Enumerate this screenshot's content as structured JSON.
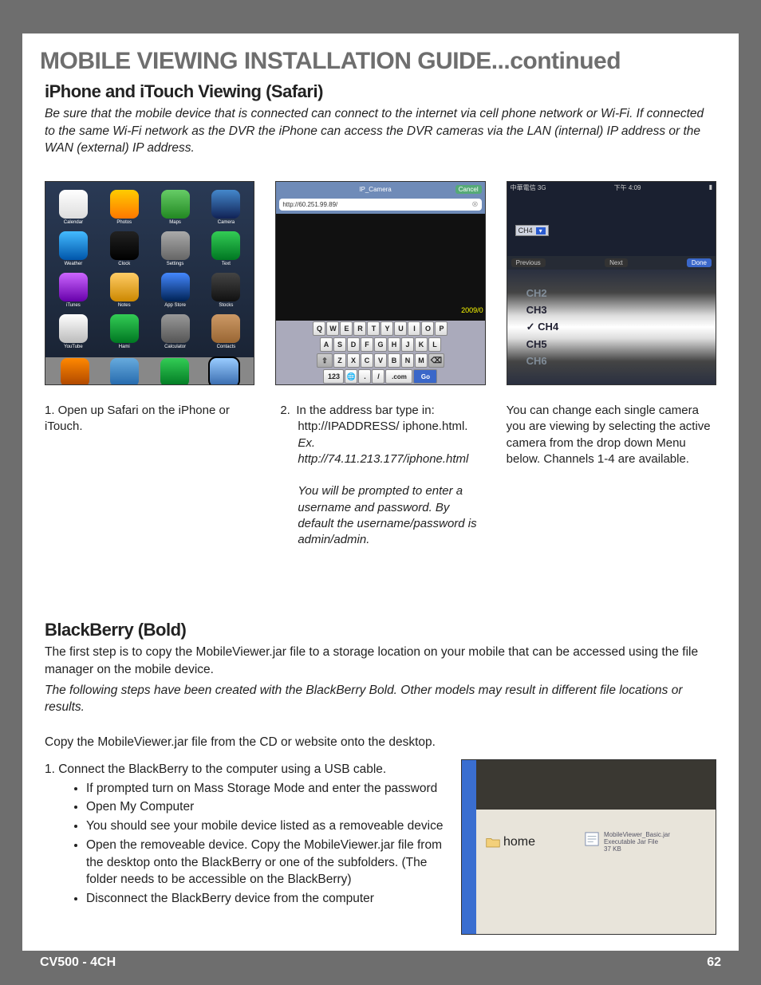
{
  "section_title": "MOBILE VIEWING INSTALLATION GUIDE...continued",
  "iphone": {
    "title": "iPhone and iTouch Viewing (Safari)",
    "intro": "Be sure that the mobile device that is connected can connect to the internet via cell phone network or Wi-Fi. If connected to the same Wi-Fi network as the DVR the iPhone can access the DVR cameras via the LAN (internal) IP address or the WAN (external) IP address.",
    "home_icons": [
      "Calendar",
      "Photos",
      "Maps",
      "Camera",
      "Weather",
      "Clock",
      "Settings",
      "Text",
      "iTunes",
      "Notes",
      "App Store",
      "Stocks",
      "YouTube",
      "Hami",
      "Calculator",
      "Contacts"
    ],
    "dock_icons": [
      "iPod",
      "Mail",
      "Phone",
      "Safari"
    ],
    "safari": {
      "title": "IP_Camera",
      "cancel": "Cancel",
      "url": "http://60.251.99.89/",
      "kb_row1": [
        "Q",
        "W",
        "E",
        "R",
        "T",
        "Y",
        "U",
        "I",
        "O",
        "P"
      ],
      "kb_row2": [
        "A",
        "S",
        "D",
        "F",
        "G",
        "H",
        "J",
        "K",
        "L"
      ],
      "kb_row3": [
        "Z",
        "X",
        "C",
        "V",
        "B",
        "N",
        "M"
      ],
      "kb_bottom": {
        "num": "123",
        "slash": "/",
        "period": ".",
        "com": ".com",
        "go": "Go"
      },
      "timestamp": "2009/0"
    },
    "picker": {
      "status_left": "中華電信 3G",
      "status_right": "下午 4:09",
      "dropdown": "CH4",
      "prev": "Previous",
      "next": "Next",
      "done": "Done",
      "rows": [
        "CH2",
        "CH3",
        "CH4",
        "CH5",
        "CH6"
      ]
    },
    "captions": {
      "c1": "1. Open up Safari on the iPhone or iTouch.",
      "c2_num": "2.",
      "c2_l1": "In the address bar type in:",
      "c2_l2": "http://IPADDRESS/ iphone.html.",
      "c2_l3": "Ex. http://74.11.213.177/iphone.html",
      "c2_l4": "You will be prompted to enter a username and password. By default the username/password is admin/admin.",
      "c3": "You can change each single camera you are viewing by selecting the active camera from the drop down Menu below. Channels 1-4 are available."
    }
  },
  "bb": {
    "title": "BlackBerry (Bold)",
    "intro1": "The first step is to copy the MobileViewer.jar file to a storage location on your mobile that can be accessed using the file manager on the mobile device.",
    "intro2": "The following steps have been created with the BlackBerry Bold. Other models may result in different file locations or results.",
    "copy_line": "Copy the MobileViewer.jar file from the CD or website onto the desktop.",
    "step1": "1.    Connect the BlackBerry to the computer using a USB cable.",
    "bullets": [
      "If prompted turn on Mass Storage Mode and enter the password",
      "Open My Computer",
      "You should see your mobile device listed as a removeable device",
      "Open the removeable device. Copy the MobileViewer.jar file from the desktop onto the BlackBerry or one of the subfolders. (The folder needs to be accessible on the BlackBerry)",
      "Disconnect the BlackBerry device from the computer"
    ],
    "file": {
      "folder": "home",
      "name": "MobileViewer_Basic.jar",
      "desc": "Executable Jar File",
      "size": "37 KB"
    }
  },
  "footer": {
    "left": "CV500 - 4CH",
    "right": "62"
  }
}
